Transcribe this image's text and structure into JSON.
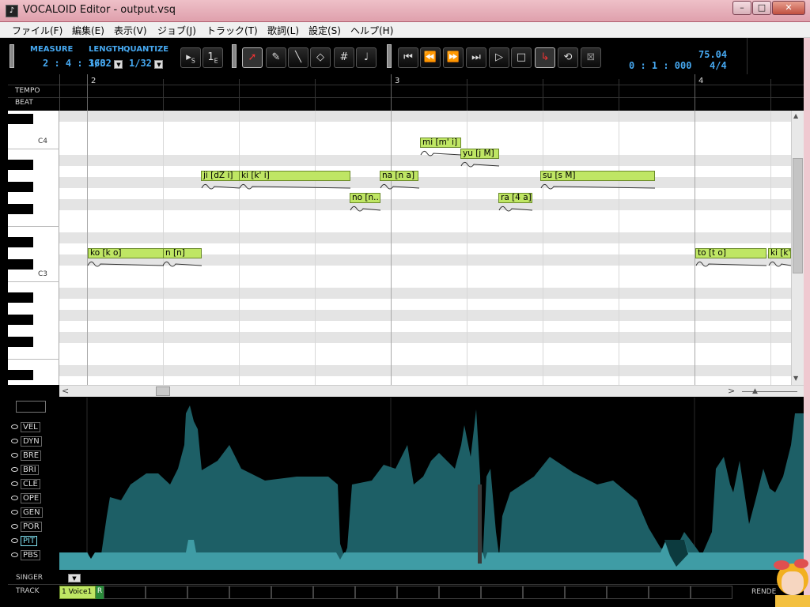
{
  "window": {
    "title": "VOCALOID Editor - output.vsq",
    "minimize": "–",
    "maximize": "□",
    "close": "✕"
  },
  "menu": [
    "ファイル(F)",
    "編集(E)",
    "表示(V)",
    "ジョブ(J)",
    "トラック(T)",
    "歌詞(L)",
    "設定(S)",
    "ヘルプ(H)"
  ],
  "toolbar": {
    "measure_label": "MEASURE",
    "measure_value": "2 : 4 : 360",
    "length_label": "LENGTH",
    "length_value": "1/32",
    "quantize_label": "QUANTIZE",
    "quantize_value": "1/32",
    "start_marker": "S",
    "end_marker": "E",
    "time": "0 : 1 : 000",
    "tempo": "75.04",
    "time_signature": "4/4"
  },
  "ruler": {
    "tempo_label": "TEMPO",
    "beat_label": "BEAT",
    "measures": [
      "2",
      "3",
      "4"
    ]
  },
  "keyboard": {
    "c4": "C4",
    "c3": "C3"
  },
  "notes": [
    {
      "lyric": "ko [k o]"
    },
    {
      "lyric": "n [n]"
    },
    {
      "lyric": "ji [dZ i]"
    },
    {
      "lyric": "ki [k' i]"
    },
    {
      "lyric": "no [n..."
    },
    {
      "lyric": "na [n a]"
    },
    {
      "lyric": "mi [m' i]"
    },
    {
      "lyric": "yu [j M]"
    },
    {
      "lyric": "ra [4 a]"
    },
    {
      "lyric": "su [s M]"
    },
    {
      "lyric": "to [t o]"
    },
    {
      "lyric": "ki [k'"
    }
  ],
  "controls": [
    "VEL",
    "DYN",
    "BRE",
    "BRI",
    "CLE",
    "OPE",
    "GEN",
    "POR",
    "PIT",
    "PBS"
  ],
  "selected_control": "PIT",
  "bottom": {
    "singer_label": "SINGER",
    "track_label": "TRACK",
    "track_name": "1 Voice1",
    "track_r": "R",
    "render_label": "RENDE"
  },
  "colors": {
    "note_fill": "#bfe664",
    "curve_fill": "#1d5f66",
    "accent_text": "#46a8f0"
  }
}
